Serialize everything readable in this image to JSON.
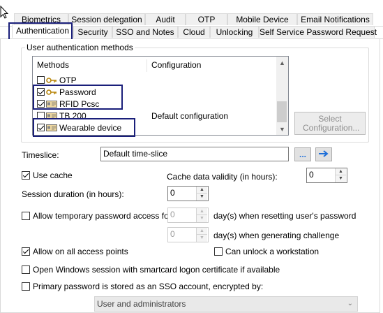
{
  "tabs_row1": [
    {
      "label": "Biometrics"
    },
    {
      "label": "Session delegation"
    },
    {
      "label": "Audit"
    },
    {
      "label": "OTP"
    },
    {
      "label": "Mobile Device"
    },
    {
      "label": "Email Notifications"
    }
  ],
  "tabs_row2": [
    {
      "label": "Authentication",
      "active": true
    },
    {
      "label": "Security"
    },
    {
      "label": "SSO and Notes"
    },
    {
      "label": "Cloud"
    },
    {
      "label": "Unlocking"
    },
    {
      "label": "Self Service Password Request"
    }
  ],
  "methods_group": {
    "title": "User authentication methods",
    "col_methods": "Methods",
    "col_configuration": "Configuration",
    "rows": [
      {
        "label": "OTP",
        "checked": false,
        "icon": "key-icon",
        "config": ""
      },
      {
        "label": "Password",
        "checked": true,
        "icon": "key-icon",
        "config": ""
      },
      {
        "label": "RFID Pcsc",
        "checked": true,
        "icon": "card-reader-icon",
        "config": ""
      },
      {
        "label": "TB 200",
        "checked": false,
        "icon": "card-reader-icon",
        "config": "Default configuration"
      },
      {
        "label": "Wearable device",
        "checked": true,
        "icon": "card-reader-icon",
        "config": ""
      }
    ],
    "select_configuration_label": "Select Configuration..."
  },
  "timeslice": {
    "label": "Timeslice:",
    "value": "Default time-slice",
    "browse_label": "...",
    "go_icon": "arrow-right-icon"
  },
  "use_cache": {
    "label": "Use cache",
    "checked": true
  },
  "cache_validity": {
    "label": "Cache data validity (in hours):",
    "value": "0"
  },
  "session_duration": {
    "label": "Session duration (in hours):",
    "value": "0"
  },
  "temp_password": {
    "label": "Allow temporary password access for:",
    "checked": false,
    "value1": "0",
    "suffix1": "day(s) when resetting user's password",
    "value2": "0",
    "suffix2": "day(s) when generating challenge"
  },
  "allow_all_access_points": {
    "label": "Allow on all access points",
    "checked": true
  },
  "can_unlock_workstation": {
    "label": "Can unlock a workstation",
    "checked": false
  },
  "open_windows_session": {
    "label": "Open Windows session with smartcard logon certificate if available",
    "checked": false
  },
  "primary_password_sso": {
    "label": "Primary password is stored as an SSO account, encrypted by:",
    "checked": false
  },
  "encrypted_by": {
    "selected": "User and administrators"
  },
  "colors": {
    "highlight": "#1a1f7a",
    "go_button": "#1e6fd9"
  }
}
